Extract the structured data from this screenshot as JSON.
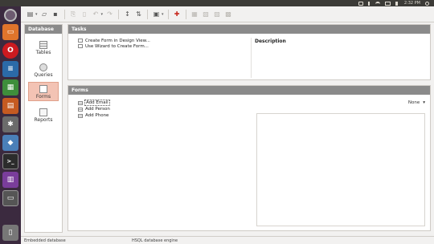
{
  "top_panel": {
    "clock": "2:32 PM",
    "tray_icons": [
      "mail-icon",
      "bluetooth-icon",
      "wifi-icon",
      "battery-icon",
      "volume-icon",
      "gear-icon"
    ]
  },
  "launcher": {
    "apps": [
      "dash-icon",
      "files-icon",
      "opera-icon",
      "writer-icon",
      "calc-icon",
      "impress-icon",
      "settings-icon",
      "cube-icon",
      "terminal-icon",
      "base-icon",
      "display-icon",
      "trash-icon"
    ]
  },
  "database_panel": {
    "header": "Database",
    "items": [
      {
        "label": "Tables",
        "icon": "tables-icon"
      },
      {
        "label": "Queries",
        "icon": "queries-icon"
      },
      {
        "label": "Forms",
        "icon": "forms-icon",
        "selected": true
      },
      {
        "label": "Reports",
        "icon": "reports-icon"
      }
    ]
  },
  "tasks_panel": {
    "header": "Tasks",
    "tasks": [
      "Create Form in Design View...",
      "Use Wizard to Create Form..."
    ],
    "description_title": "Description"
  },
  "forms_panel": {
    "header": "Forms",
    "forms": [
      "Add Email",
      "Add Person",
      "Add Phone"
    ],
    "preview_mode": "None"
  },
  "statusbar": {
    "left": "Embedded database",
    "middle": "HSQL database engine"
  },
  "colors": {
    "selected_bg": "#f3c3b4",
    "header_bg": "#8a8a8a",
    "top_panel_bg": "#3c3b37",
    "launcher_bg": "#3b2a3f"
  }
}
